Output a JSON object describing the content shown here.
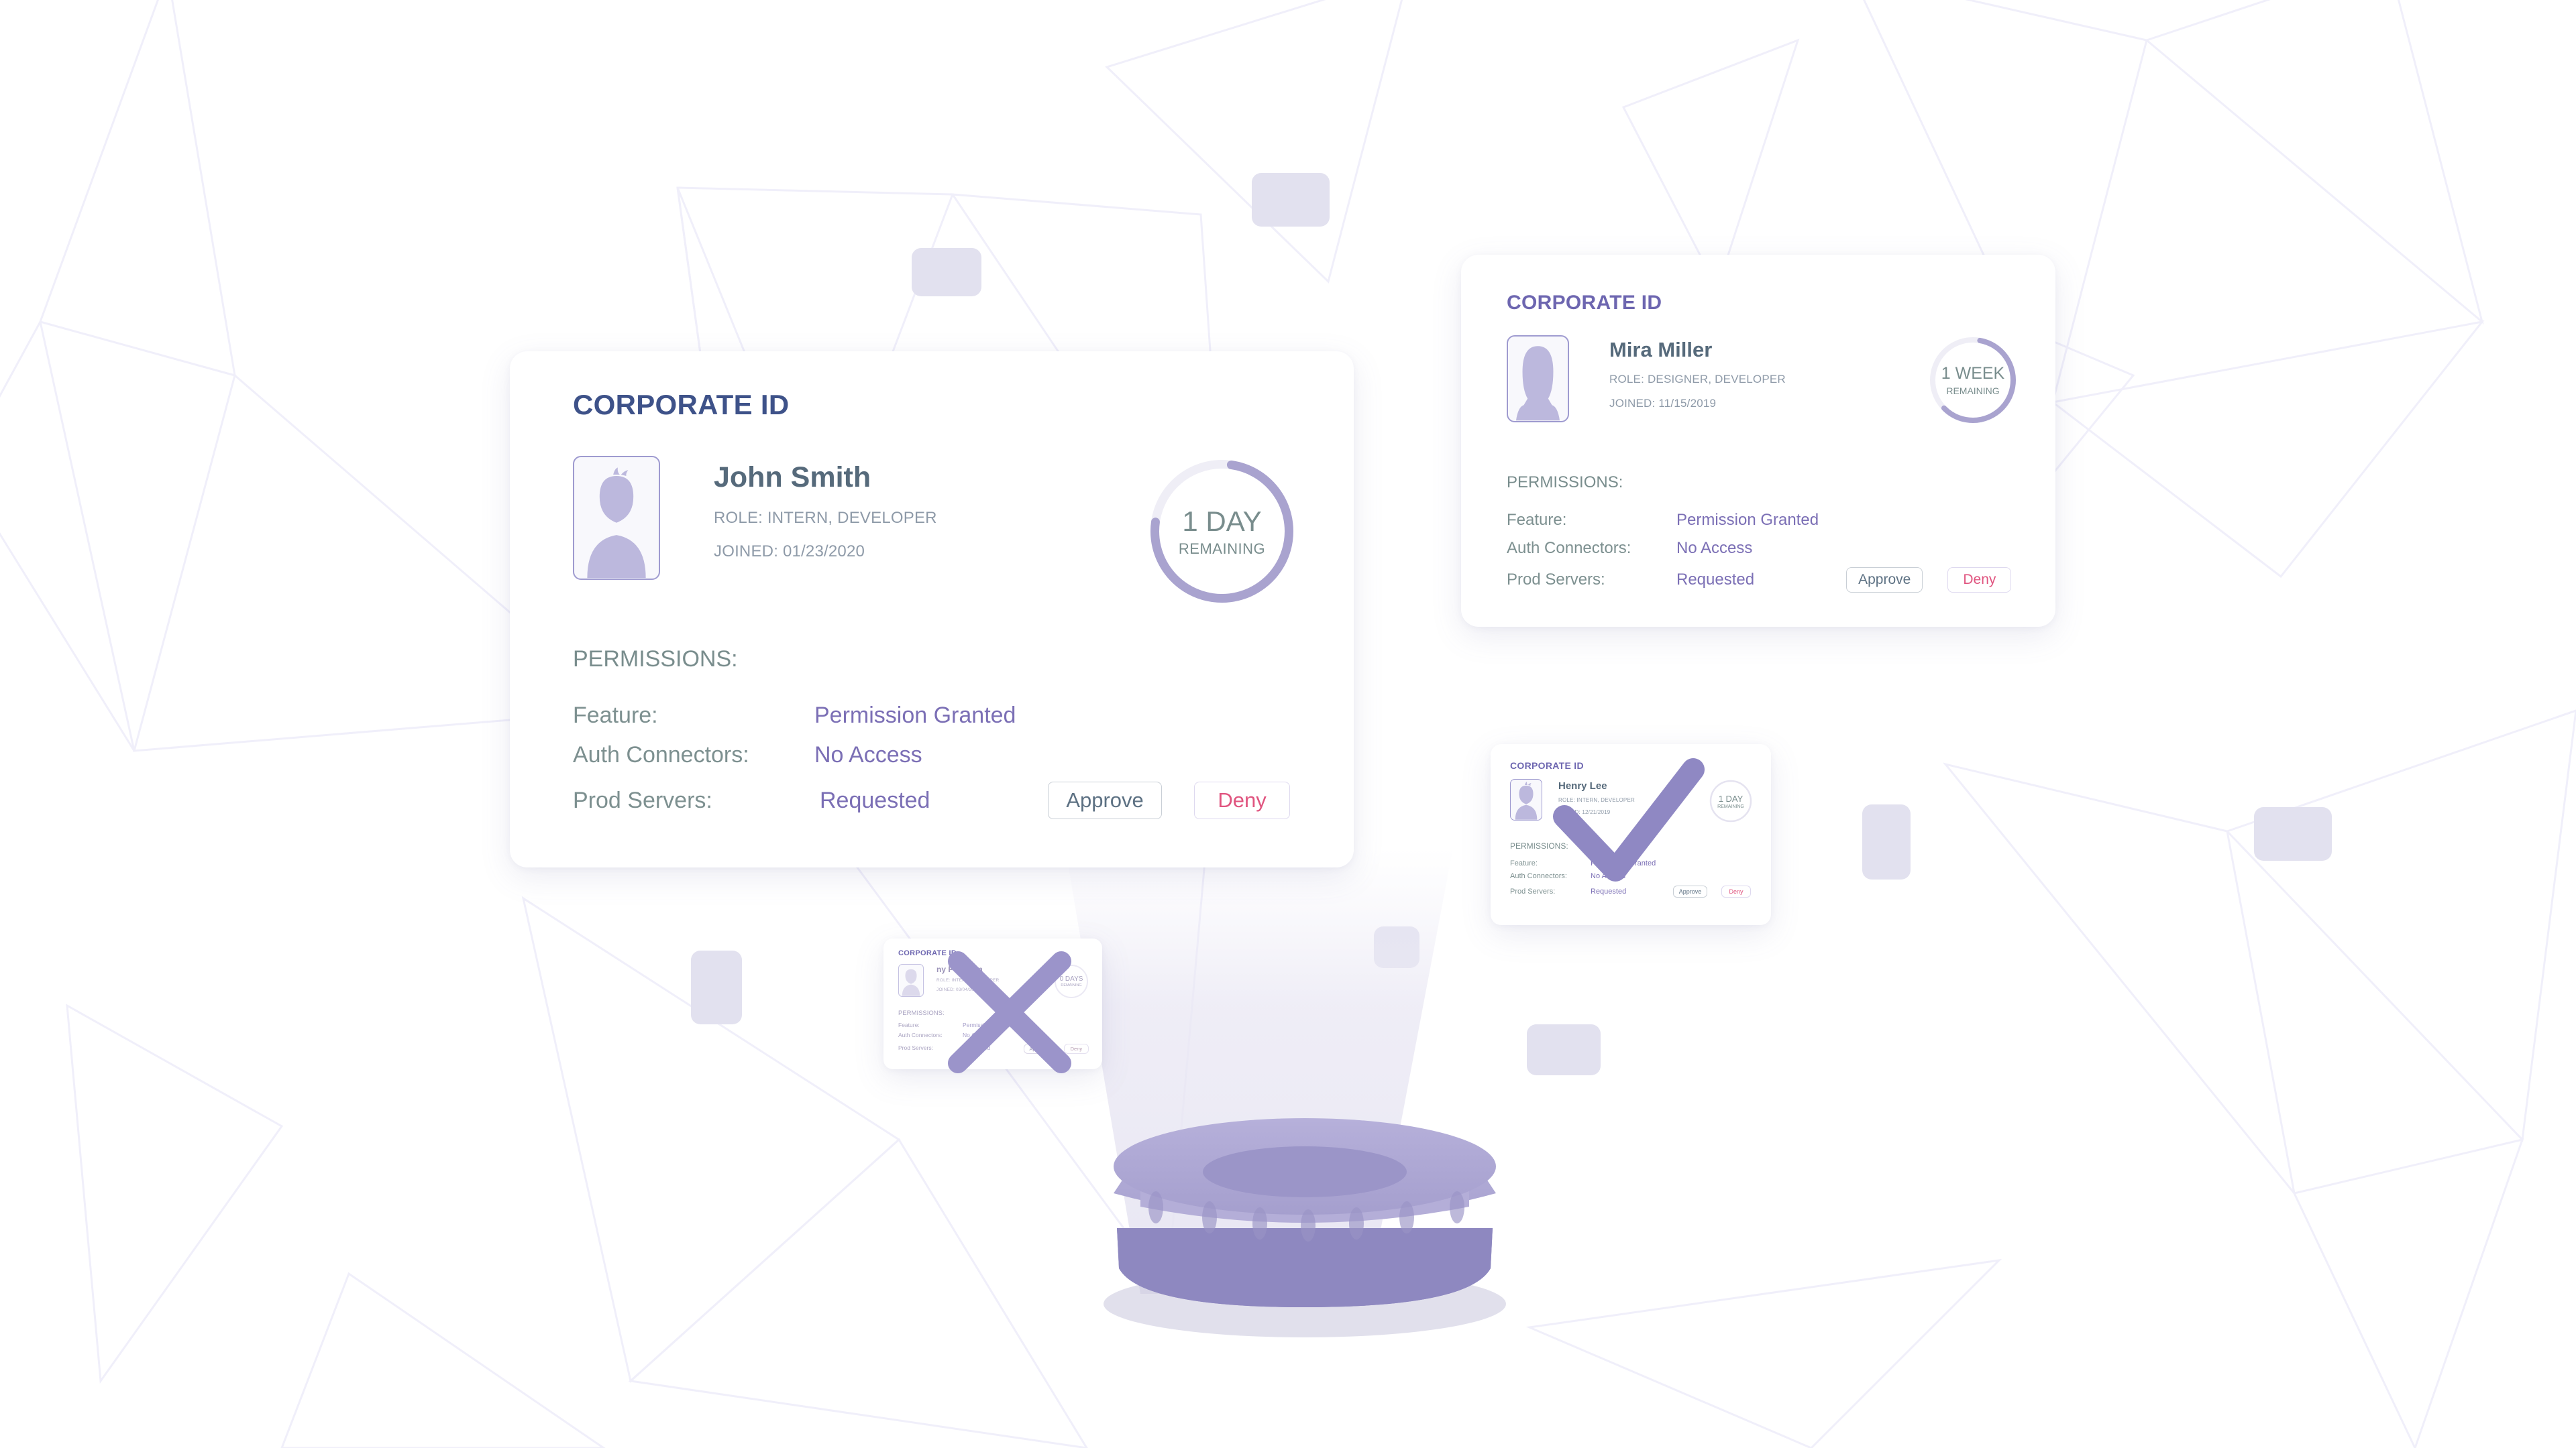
{
  "colors": {
    "title": "#3e5289",
    "name": "#566a7b",
    "meta": "#8e9aa8",
    "perm_label": "#7d9090",
    "perm_value": "#7b6fb5",
    "ring_active": "#a9a3cf",
    "ring_track": "#efeef6",
    "approve_text": "#5d7183",
    "deny_text": "#e0547f",
    "avatar_border": "#9f9bd0",
    "avatar_fill": "#bcb8dd",
    "pedestal_top": "#aaa4d2",
    "pedestal_mid": "#b4aed8",
    "pedestal_base": "#8e88c0",
    "beam": "#e9e7f3",
    "float_rect": "#e2e1ef",
    "background": "#ffffff",
    "poly_stroke": "#f0effa"
  },
  "common": {
    "card_title": "CORPORATE ID",
    "permissions_heading": "PERMISSIONS:",
    "approve_label": "Approve",
    "deny_label": "Deny",
    "remaining_label": "REMAINING",
    "permission_labels": [
      "Feature:",
      "Auth Connectors:",
      "Prod Servers:"
    ]
  },
  "cards": [
    {
      "id": "john-smith",
      "title": "CORPORATE ID",
      "name": "John Smith",
      "role": "ROLE: INTERN, DEVELOPER",
      "joined": "JOINED: 01/23/2020",
      "avatar_type": "male-avatar-icon",
      "countdown_value": "1 DAY",
      "countdown_sub": "REMAINING",
      "ring_percent": 75,
      "permissions_heading": "PERMISSIONS:",
      "permissions": [
        {
          "label": "Feature:",
          "value": "Permission Granted"
        },
        {
          "label": "Auth Connectors:",
          "value": "No Access"
        },
        {
          "label": "Prod Servers:",
          "value": "Requested"
        }
      ],
      "approve_label": "Approve",
      "deny_label": "Deny",
      "overlay_mark": "none"
    },
    {
      "id": "mira-miller",
      "title": "CORPORATE ID",
      "name": "Mira Miller",
      "role": "ROLE: DESIGNER, DEVELOPER",
      "joined": "JOINED: 11/15/2019",
      "avatar_type": "female-avatar-icon",
      "countdown_value": "1 WEEK",
      "countdown_sub": "REMAINING",
      "ring_percent": 60,
      "permissions_heading": "PERMISSIONS:",
      "permissions": [
        {
          "label": "Feature:",
          "value": "Permission Granted"
        },
        {
          "label": "Auth Connectors:",
          "value": "No Access"
        },
        {
          "label": "Prod Servers:",
          "value": "Requested"
        }
      ],
      "approve_label": "Approve",
      "deny_label": "Deny",
      "overlay_mark": "none"
    },
    {
      "id": "henry-lee",
      "title": "CORPORATE ID",
      "name": "Henry Lee",
      "role": "ROLE: INTERN, DEVELOPER",
      "joined": "JOINED: 12/21/2019",
      "avatar_type": "male-avatar-icon",
      "countdown_value": "1 DAY",
      "countdown_sub": "REMAINING",
      "ring_percent": 100,
      "permissions_heading": "PERMISSIONS:",
      "permissions": [
        {
          "label": "Feature:",
          "value": "Permission Granted"
        },
        {
          "label": "Auth Connectors:",
          "value": "No Access"
        },
        {
          "label": "Prod Servers:",
          "value": "Requested"
        }
      ],
      "approve_label": "Approve",
      "deny_label": "Deny",
      "overlay_mark": "checkmark"
    },
    {
      "id": "peterson",
      "title": "CORPORATE ID",
      "name": "ny Peterson",
      "role": "ROLE: INTERN, DEVELOPER",
      "joined": "JOINED: 03/04/2019",
      "avatar_type": "male-avatar-icon",
      "countdown_value": "0 DAYS",
      "countdown_sub": "REMAINING",
      "ring_percent": 0,
      "permissions_heading": "PERMISSIONS:",
      "permissions": [
        {
          "label": "Feature:",
          "value": "Permission Granted"
        },
        {
          "label": "Auth Connectors:",
          "value": "No Access"
        },
        {
          "label": "Prod Servers:",
          "value": "Requested"
        }
      ],
      "approve_label": "Approve",
      "deny_label": "Deny",
      "overlay_mark": "cross"
    }
  ],
  "scene": {
    "projector": "hologram-projector-pedestal",
    "beam": "light-beam-cone"
  }
}
